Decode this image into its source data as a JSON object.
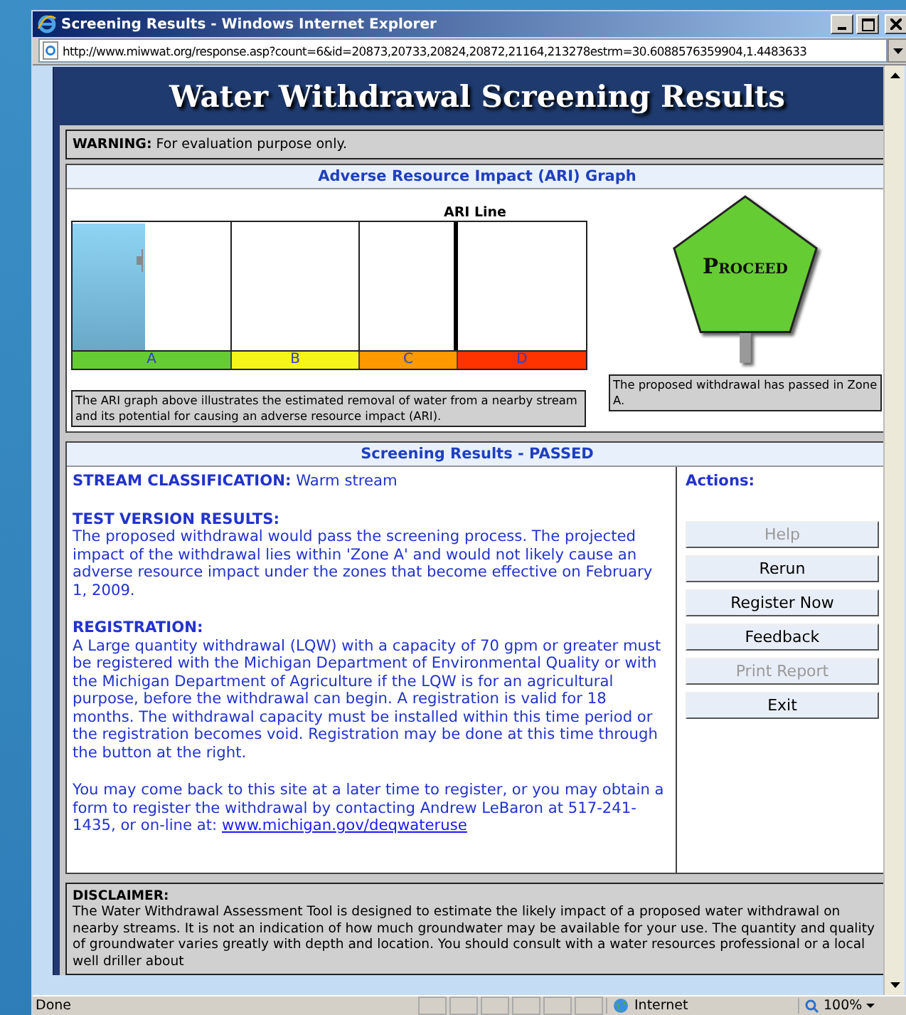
{
  "window": {
    "title": "Screening Results - Windows Internet Explorer"
  },
  "address_bar": {
    "value": "http://www.miwwat.org/response.asp?count=6&id=20873,20733,20824,20872,21164,213278estrm=30.6088576359904,1.4483633"
  },
  "page": {
    "title": "Water Withdrawal Screening Results",
    "warning": "**WARNING:** For evaluation purpose only.",
    "graph_section": {
      "title": "Adverse Resource Impact (ARI) Graph",
      "ari_line_label": "ARI Line",
      "level": 0.14,
      "zones": [
        {
          "label": "A",
          "color": "#66cc33"
        },
        {
          "label": "B",
          "color": "#f5f51a"
        },
        {
          "label": "C",
          "color": "#ff9900"
        },
        {
          "label": "D",
          "color": "#ff3300"
        }
      ],
      "graph_note": "The ARI graph above illustrates the estimated removal of water from a nearby stream and its potential for causing an adverse resource impact (ARI).",
      "sign": {
        "text": "Proceed",
        "color": "#66cc33"
      },
      "sign_note": "The proposed withdrawal has passed in Zone A."
    },
    "results_section": {
      "title": "Screening Results - PASSED",
      "classification": "**STREAM CLASSIFICATION:** Warm stream",
      "test_heading": "TEST VERSION RESULTS:",
      "test_text": "The proposed withdrawal would pass the screening process. The projected impact of the withdrawal lies within 'Zone A' and would not likely cause an adverse resource impact under the zones that become effective on February 1, 2009.",
      "registration_heading": "REGISTRATION:",
      "registration_text": "A Large quantity withdrawal (LQW) with a capacity of 70 gpm or greater must be registered with the Michigan Department of Environmental Quality or with the Michigan Department of Agriculture if the LQW is for an agricultural purpose, before the withdrawal can begin. A registration is valid for 18 months. The withdrawal capacity must be installed within this time period or the registration becomes void. Registration may be done at this time through the button at the right.",
      "contact_text": "You may come back to this site at a later time to register, or you may obtain a form to register the withdrawal by contacting Andrew LeBaron at 517-241-1435, or on-line at:",
      "contact_link": "www.michigan.gov/deqwateruse",
      "actions_title": "Actions:",
      "actions": [
        {
          "label": "Help",
          "disabled": true
        },
        {
          "label": "Rerun",
          "disabled": false
        },
        {
          "label": "Register Now",
          "disabled": false
        },
        {
          "label": "Feedback",
          "disabled": false
        },
        {
          "label": "Print Report",
          "disabled": true
        },
        {
          "label": "Exit",
          "disabled": false
        }
      ]
    },
    "disclaimer": {
      "heading": "DISCLAIMER:",
      "text": "The Water Withdrawal Assessment Tool is designed to estimate the likely impact of a proposed water withdrawal on nearby streams. It is not an indication of how much groundwater may be available for your use. The quantity and quality of groundwater varies greatly with depth and location. You should consult with a water resources professional or a local well driller about"
    }
  },
  "status_bar": {
    "status": "Done",
    "zone": "Internet",
    "zoom": "100%"
  }
}
